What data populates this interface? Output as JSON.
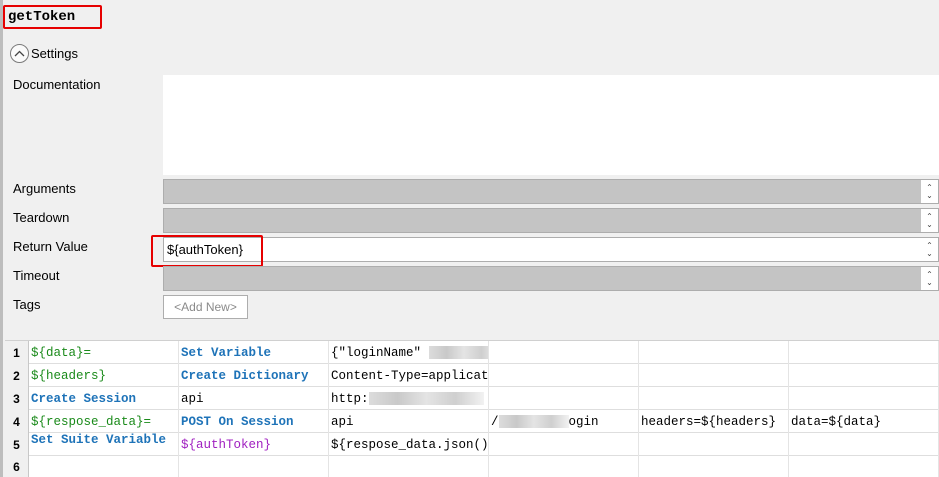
{
  "keyword_name": "getToken",
  "settings_label": "Settings",
  "labels": {
    "documentation": "Documentation",
    "arguments": "Arguments",
    "teardown": "Teardown",
    "return_value": "Return Value",
    "timeout": "Timeout",
    "tags": "Tags"
  },
  "return_value": "${authToken}",
  "add_new": "<Add New>",
  "colors": {
    "highlight": "#e60000",
    "keyword": "#1e73b8",
    "variable": "#1a8a1a",
    "suite_variable": "#a020c0"
  },
  "rows": [
    {
      "num": "1",
      "c1": "${data}=",
      "c2": "Set Variable",
      "c3": "{\"loginName\"",
      "c4": "",
      "c5": "",
      "c6": ""
    },
    {
      "num": "2",
      "c1": "${headers}",
      "c2": "Create Dictionary",
      "c3": "Content-Type=applicatio",
      "c4": "",
      "c5": "",
      "c6": ""
    },
    {
      "num": "3",
      "c1": "Create Session",
      "c2": "api",
      "c3": "http:",
      "c4": "",
      "c5": "",
      "c6": ""
    },
    {
      "num": "4",
      "c1": "${respose_data}=",
      "c2": "POST On Session",
      "c3": "api",
      "c4": "/",
      "c4b": "ogin",
      "c5": "headers=${headers}",
      "c6": "data=${data}"
    },
    {
      "num": "5",
      "c1": "Set Suite Variable",
      "c2": "${authToken}",
      "c3": "${respose_data.json()}[",
      "c4": "",
      "c5": "",
      "c6": ""
    },
    {
      "num": "6",
      "c1": "",
      "c2": "",
      "c3": "",
      "c4": "",
      "c5": "",
      "c6": ""
    }
  ]
}
